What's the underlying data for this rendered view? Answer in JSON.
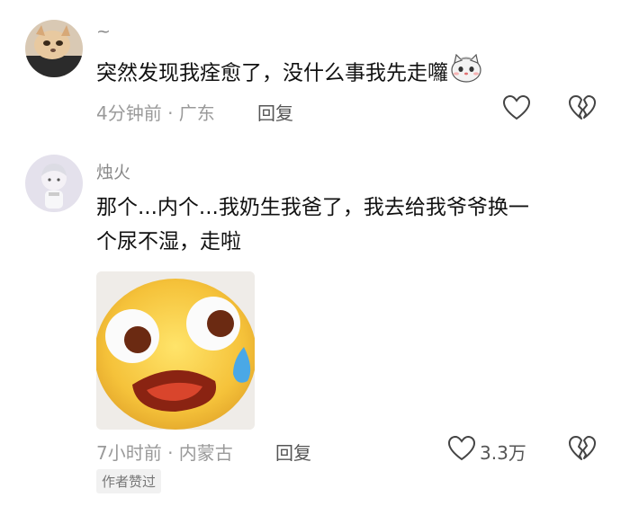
{
  "comments": [
    {
      "username": "~",
      "text": "突然发现我痊愈了，没什么事我先走�womb",
      "text_main": "突然发现我痊愈了，没什么事我先走",
      "text_end": "囖",
      "time_location": "4分钟前 · 广东",
      "reply_label": "回复",
      "avatar_icon": "cat-photo-avatar",
      "emoji_icon": "cat-face-icon"
    },
    {
      "username": "烛火",
      "text_line1": "那个...内个...我奶生我爸了，我去给我爷爷换一",
      "text_line2": "个尿不湿，走啦",
      "time_location": "7小时前 · 内蒙古",
      "reply_label": "回复",
      "like_count": "3.3万",
      "badge": "作者赞过",
      "avatar_icon": "anime-boy-avatar",
      "sticker_icon": "shocked-emoji-sticker"
    }
  ],
  "colors": {
    "meta_gray": "#9a9a9a",
    "text": "#111111"
  }
}
